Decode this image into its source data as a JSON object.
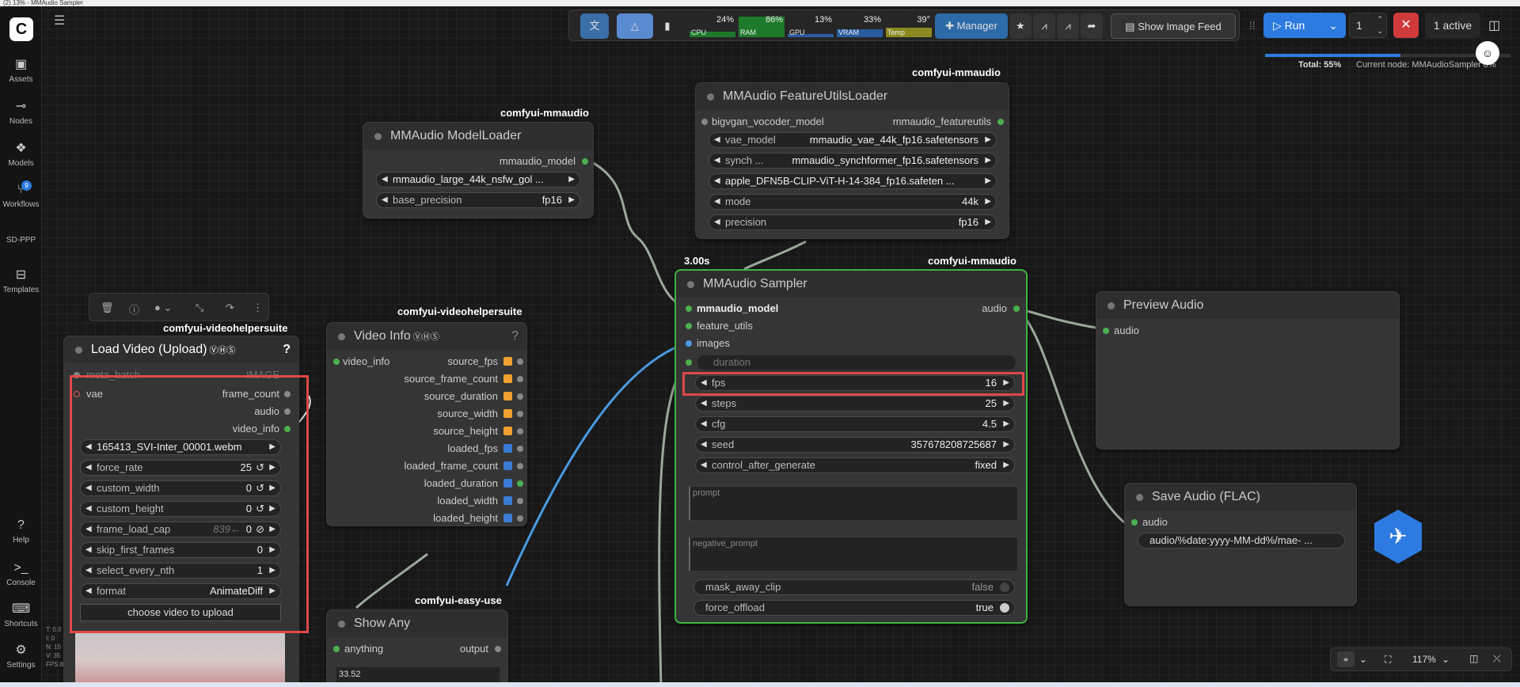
{
  "window": {
    "title": "(2) 13% - MMAudio Sampler"
  },
  "sidebar": {
    "items": [
      {
        "label": "Assets"
      },
      {
        "label": "Nodes"
      },
      {
        "label": "Models"
      },
      {
        "label": "Workflows",
        "badge": "9"
      },
      {
        "label": "SD-PPP"
      },
      {
        "label": "Templates"
      },
      {
        "label": "Help"
      },
      {
        "label": "Console"
      },
      {
        "label": "Shortcuts"
      },
      {
        "label": "Settings"
      }
    ]
  },
  "topbar": {
    "stats": [
      {
        "label": "CPU",
        "value": "24%",
        "fill": 0.24
      },
      {
        "label": "RAM",
        "value": "86%",
        "fill": 0.86
      },
      {
        "label": "GPU",
        "value": "13%",
        "fill": 0.13
      },
      {
        "label": "VRAM",
        "value": "33%",
        "fill": 0.33
      },
      {
        "label": "Temp",
        "value": "39°",
        "fill": 0.39
      }
    ],
    "manager_label": "Manager",
    "show_image_feed": "Show Image Feed",
    "run_label": "Run",
    "batch_count": "1",
    "active_label": "1 active",
    "total_label": "Total: 55%",
    "total_progress": 0.55,
    "current_node": "Current node: MMAudioSampler 0%"
  },
  "nodes": {
    "model_loader": {
      "tag": "comfyui-mmaudio",
      "title": "MMAudio ModelLoader",
      "output": "mmaudio_model",
      "widgets": [
        {
          "label": "",
          "value": "mmaudio_large_44k_nsfw_gol ..."
        },
        {
          "label": "base_precision",
          "value": "fp16"
        }
      ]
    },
    "feature_loader": {
      "tag": "comfyui-mmaudio",
      "title": "MMAudio FeatureUtilsLoader",
      "input": "bigvgan_vocoder_model",
      "output": "mmaudio_featureutils",
      "widgets": [
        {
          "label": "vae_model",
          "value": "mmaudio_vae_44k_fp16.safetensors"
        },
        {
          "label": "synch ...",
          "value": "mmaudio_synchformer_fp16.safetensors"
        },
        {
          "label": "",
          "value": "apple_DFN5B-CLIP-ViT-H-14-384_fp16.safeten ..."
        },
        {
          "label": "mode",
          "value": "44k"
        },
        {
          "label": "precision",
          "value": "fp16"
        }
      ]
    },
    "sampler": {
      "time": "3.00s",
      "tag": "comfyui-mmaudio",
      "title": "MMAudio Sampler",
      "inputs": [
        "mmaudio_model",
        "feature_utils",
        "images"
      ],
      "output": "audio",
      "duration_label": "duration",
      "widgets": [
        {
          "label": "fps",
          "value": "16"
        },
        {
          "label": "steps",
          "value": "25"
        },
        {
          "label": "cfg",
          "value": "4.5"
        },
        {
          "label": "seed",
          "value": "357678208725687"
        },
        {
          "label": "control_after_generate",
          "value": "fixed"
        }
      ],
      "prompt_placeholder": "prompt",
      "negative_prompt_placeholder": "negative_prompt",
      "toggles": [
        {
          "label": "mask_away_clip",
          "value": "false"
        },
        {
          "label": "force_offload",
          "value": "true"
        }
      ]
    },
    "preview_audio": {
      "title": "Preview Audio",
      "input": "audio"
    },
    "save_audio": {
      "title": "Save Audio (FLAC)",
      "input": "audio",
      "value": "audio/%date:yyyy-MM-dd%/mae- ..."
    },
    "load_video": {
      "tag": "comfyui-videohelpersuite",
      "title": "Load Video (Upload)",
      "inputs": [
        "meta_batch",
        "vae"
      ],
      "outputs": [
        "IMAGE",
        "frame_count",
        "audio",
        "video_info"
      ],
      "widgets": [
        {
          "label": "",
          "value": "165413_SVI-Inter_00001.webm"
        },
        {
          "label": "force_rate",
          "value": "25"
        },
        {
          "label": "custom_width",
          "value": "0"
        },
        {
          "label": "custom_height",
          "value": "0"
        },
        {
          "label": "frame_load_cap",
          "value": "0",
          "hint": "839←"
        },
        {
          "label": "skip_first_frames",
          "value": "0"
        },
        {
          "label": "select_every_nth",
          "value": "1"
        },
        {
          "label": "format",
          "value": "AnimateDiff"
        }
      ],
      "upload_label": "choose video to upload"
    },
    "video_info": {
      "tag": "comfyui-videohelpersuite",
      "title": "Video Info",
      "input": "video_info",
      "outputs": [
        "source_fps",
        "source_frame_count",
        "source_duration",
        "source_width",
        "source_height",
        "loaded_fps",
        "loaded_frame_count",
        "loaded_duration",
        "loaded_width",
        "loaded_height"
      ]
    },
    "show_any": {
      "tag": "comfyui-easy-use",
      "title": "Show Any",
      "input": "anything",
      "output": "output",
      "value": "33.52"
    }
  },
  "debug": [
    "T: 0.0",
    "I: 0",
    "N: 15",
    "V: 35",
    "FPS:8"
  ],
  "bottom": {
    "zoom": "117%"
  },
  "colors": {
    "accent": "#2d7be0",
    "highlight": "#e04848",
    "link_green": "#4caf50",
    "link_blue": "#4a9ae0"
  }
}
